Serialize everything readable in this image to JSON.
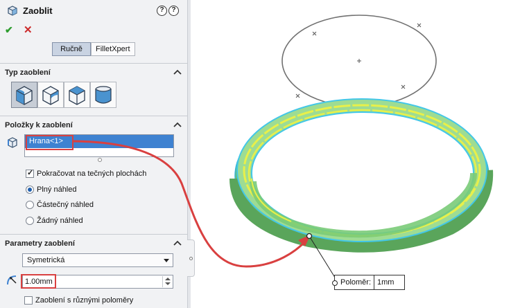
{
  "header": {
    "title": "Zaoblit",
    "help_icon": "question-icon",
    "whatsnew_icon": "help-spark-icon"
  },
  "actions": {
    "ok_icon": "checkmark-icon",
    "cancel_icon": "x-icon"
  },
  "tabs": [
    {
      "label": "Ručně",
      "active": true
    },
    {
      "label": "FilletXpert",
      "active": false
    }
  ],
  "fillet_type": {
    "title": "Typ zaoblení",
    "buttons": [
      {
        "icon": "constant-radius-fillet-icon",
        "selected": true
      },
      {
        "icon": "variable-radius-fillet-icon",
        "selected": false
      },
      {
        "icon": "face-fillet-icon",
        "selected": false
      },
      {
        "icon": "full-round-fillet-icon",
        "selected": false
      }
    ]
  },
  "items": {
    "title": "Položky k zaoblení",
    "list": [
      "Hrana<1>"
    ],
    "tangent_propagation": {
      "label": "Pokračovat na tečných plochách",
      "checked": true
    },
    "preview_options": [
      {
        "label": "Plný náhled",
        "selected": true
      },
      {
        "label": "Částečný náhled",
        "selected": false
      },
      {
        "label": "Žádný náhled",
        "selected": false
      }
    ]
  },
  "params": {
    "title": "Parametry zaoblení",
    "profile": "Symetrická",
    "radius": "1.00mm",
    "multi_radius": {
      "label": "Zaoblení s různými poloměry",
      "checked": false
    }
  },
  "viewport": {
    "callout_label": "Poloměr:",
    "callout_value": "1mm"
  },
  "colors": {
    "highlight": "#d94040",
    "selection": "#3e82d1",
    "edge_yellow": "#e8f04a",
    "edge_cyan": "#43c7e8",
    "ring_body": "#8fd08a"
  }
}
